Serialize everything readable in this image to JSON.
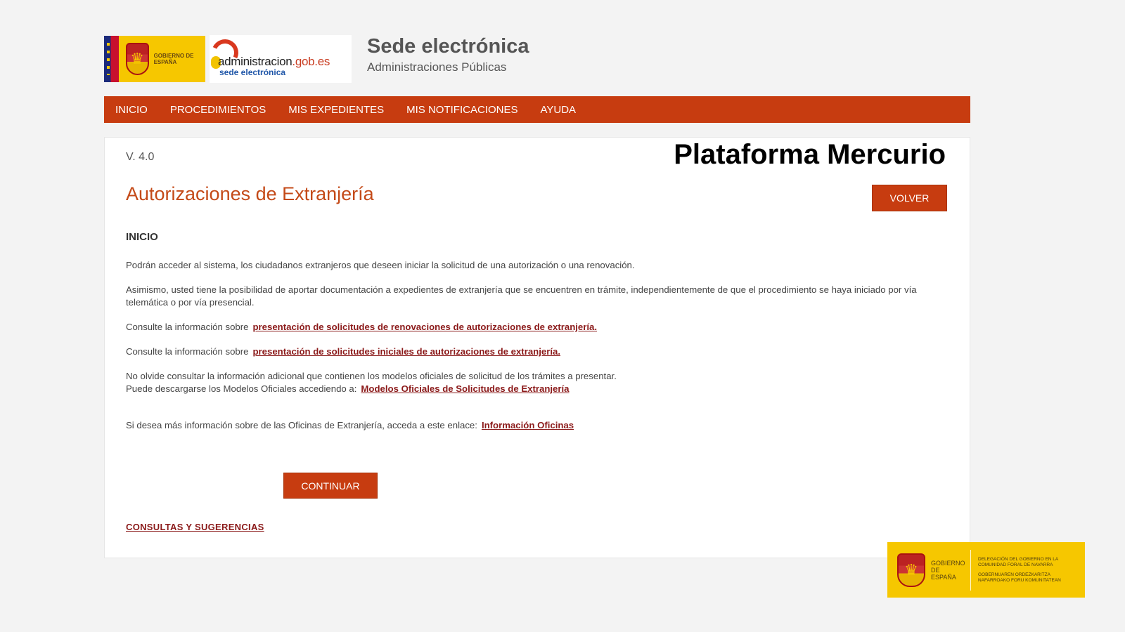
{
  "header": {
    "gob_logo_text": "GOBIERNO DE ESPAÑA",
    "admin_logo": {
      "name_part1": "administracion",
      "name_part2": ".gob.es",
      "subtitle": "sede electrónica"
    },
    "title": "Sede electrónica",
    "subtitle": "Administraciones Públicas"
  },
  "nav": {
    "items": [
      {
        "label": "INICIO"
      },
      {
        "label": "PROCEDIMIENTOS"
      },
      {
        "label": "MIS EXPEDIENTES"
      },
      {
        "label": "MIS NOTIFICACIONES"
      },
      {
        "label": "AYUDA"
      }
    ]
  },
  "main": {
    "version": "V. 4.0",
    "overlay_title": "Plataforma Mercurio",
    "page_title": "Autorizaciones de Extranjería",
    "volver_label": "VOLVER",
    "section_heading": "INICIO",
    "para1": "Podrán acceder al sistema, los ciudadanos extranjeros que deseen iniciar la solicitud de una autorización o una renovación.",
    "para2": "Asimismo, usted tiene la posibilidad de aportar documentación a expedientes de extranjería que se encuentren en trámite, independientemente de que el procedimiento se haya iniciado por vía telemática o por vía presencial.",
    "para3_text": "Consulte la información sobre",
    "para3_link": "presentación de solicitudes de renovaciones de autorizaciones de extranjería.",
    "para4_text": "Consulte la información sobre",
    "para4_link": "presentación de solicitudes iniciales de autorizaciones de extranjería.",
    "para5_line1": "No olvide consultar la información adicional que contienen los modelos oficiales de solicitud de los trámites a presentar.",
    "para5_line2": "Puede descargarse los Modelos Oficiales accediendo a:",
    "para5_link": "Modelos Oficiales de Solicitudes de Extranjería",
    "para6_text": "Si desea más información sobre de las Oficinas de Extranjería, acceda a este enlace:",
    "para6_link": "Información Oficinas",
    "continuar_label": "CONTINUAR",
    "consultas_label": "CONSULTAS Y SUGERENCIAS"
  },
  "footer": {
    "gob_text": "GOBIERNO DE ESPAÑA",
    "deleg_line1": "DELEGACIÓN DEL GOBIERNO EN LA COMUNIDAD FORAL DE NAVARRA",
    "deleg_line2": "GOBERNUAREN ORDEZKARITZA NAFARROAKO FORU KOMUNITATEAN"
  },
  "colors": {
    "accent": "#c73c10",
    "title": "#c44a18",
    "link": "#8b1a1a",
    "gob_yellow": "#f6c700"
  }
}
